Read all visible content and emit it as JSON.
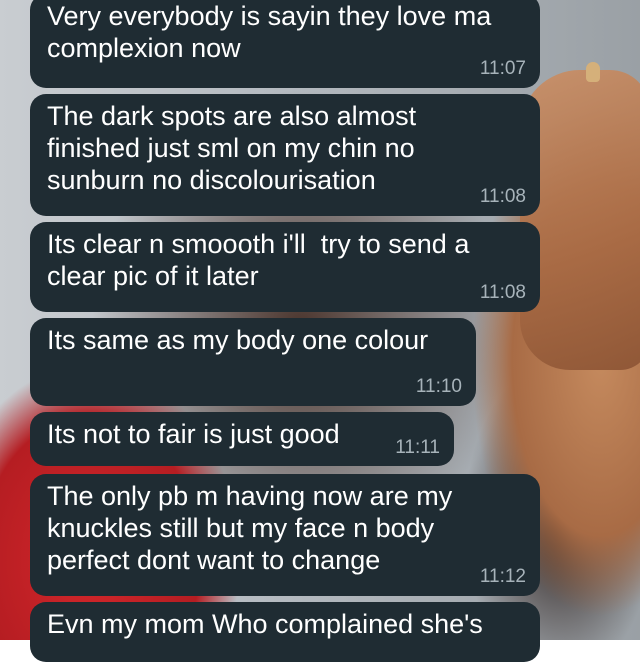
{
  "messages": [
    {
      "text": "Very everybody is sayin they love ma\ncomplexion now",
      "time": "11:07"
    },
    {
      "text": "The dark spots are also almost\nfinished just sml on my chin no\nsunburn no discolourisation",
      "time": "11:08"
    },
    {
      "text": "Its clear n smoooth i'll  try to send a\nclear pic of it later",
      "time": "11:08"
    },
    {
      "text": "Its same as my body one colour",
      "time": "11:10"
    },
    {
      "text": "Its not to fair is just good",
      "time": "11:11"
    },
    {
      "text": "The only pb m having now are my\nknuckles still but my face n body\nperfect dont want to change",
      "time": "11:12"
    },
    {
      "text": "Evn my mom Who complained she's",
      "time": ""
    }
  ],
  "colors": {
    "bubble": "#1f2c33",
    "timestamp": "#a7b3ba",
    "text": "#ffffff"
  }
}
